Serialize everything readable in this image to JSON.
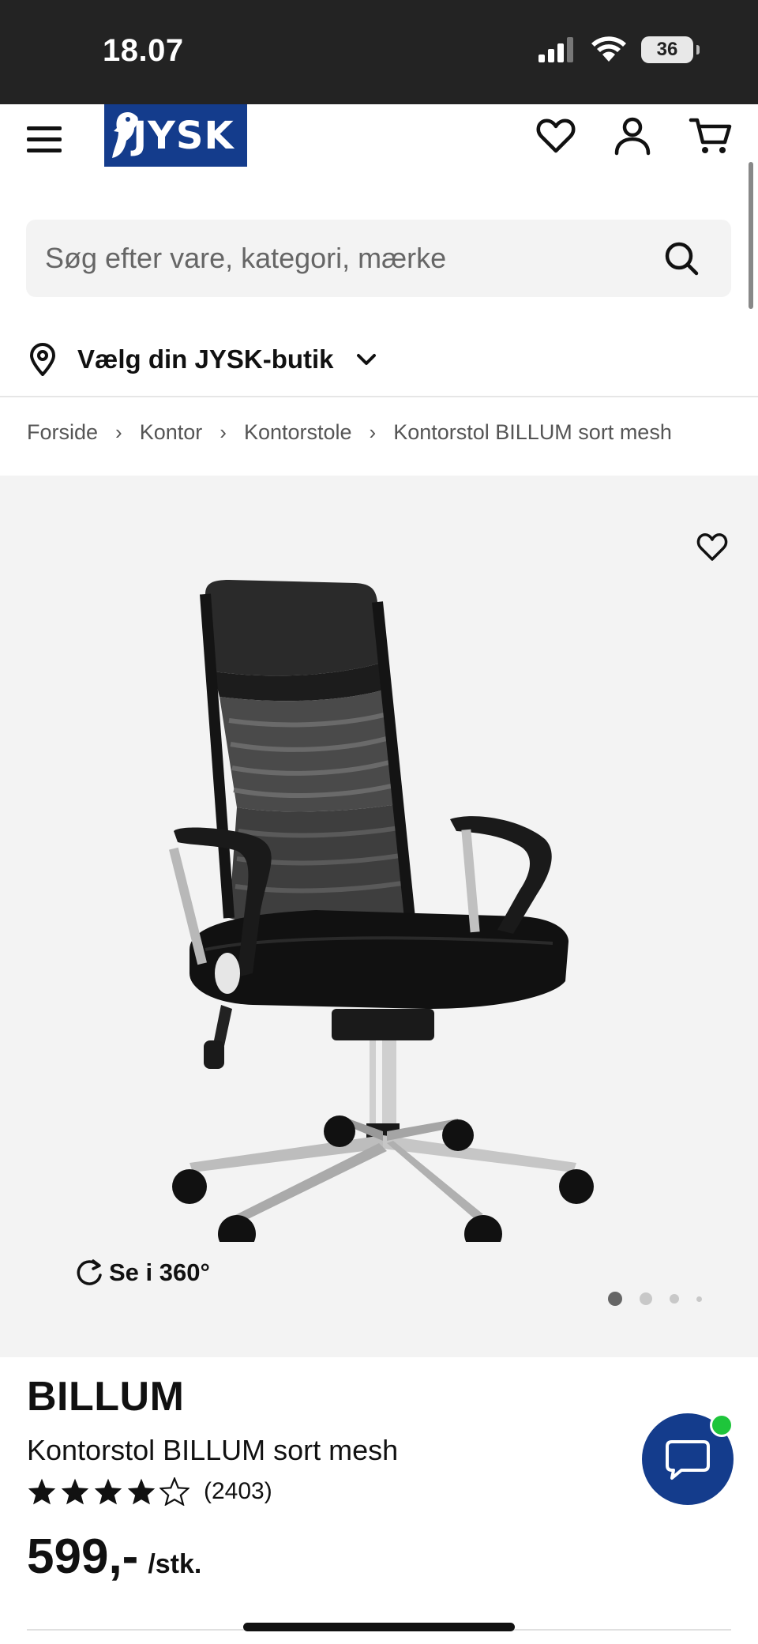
{
  "status_bar": {
    "time": "18.07",
    "battery": "36"
  },
  "header": {
    "logo_text": "JYSK",
    "menu_icon": "hamburger-icon",
    "wishlist_icon": "heart-icon",
    "account_icon": "user-icon",
    "cart_icon": "cart-icon"
  },
  "search": {
    "placeholder": "Søg efter vare, kategori, mærke",
    "icon": "search-icon"
  },
  "store": {
    "label": "Vælg din JYSK-butik",
    "icon": "location-pin-icon"
  },
  "breadcrumb": [
    "Forside",
    "Kontor",
    "Kontorstole",
    "Kontorstol BILLUM sort mesh"
  ],
  "gallery": {
    "view360_label": "Se i 360°",
    "image_count": 4,
    "active_index": 0
  },
  "product": {
    "brand": "BILLUM",
    "name": "Kontorstol BILLUM sort mesh",
    "rating": 4,
    "rating_max": 5,
    "rating_count": "(2403)",
    "price": "599,-",
    "unit": "/stk."
  },
  "colors": {
    "brand_blue": "#143c8c",
    "chat_online": "#1ec53b",
    "gallery_bg": "#f3f3f3"
  }
}
